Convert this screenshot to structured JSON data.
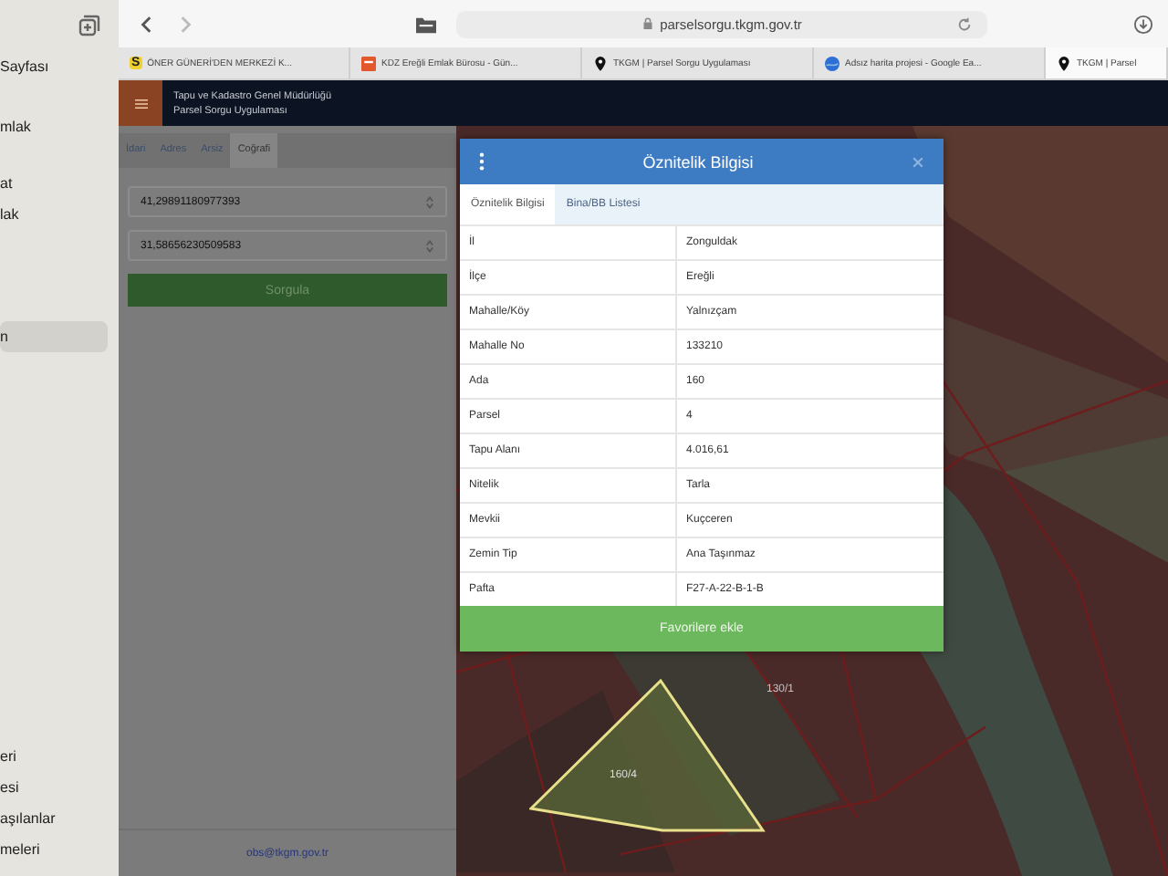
{
  "sidebar": {
    "top_items": [
      {
        "label": "Sayfası",
        "selected": false
      },
      {
        "label": "mlak",
        "selected": false
      },
      {
        "label": "at",
        "selected": false
      },
      {
        "label": "lak",
        "selected": false
      },
      {
        "label": "n",
        "selected": true
      }
    ],
    "bottom_items": [
      {
        "label": "eri",
        "selected": false
      },
      {
        "label": "esi",
        "selected": false
      },
      {
        "label": "aşılanlar",
        "selected": false
      },
      {
        "label": "meleri",
        "selected": false
      }
    ]
  },
  "browser": {
    "url": "parselsorgu.tkgm.gov.tr",
    "tabs": [
      {
        "kind": "letter",
        "badge": "S",
        "title": "ÖNER GÜNERİ'DEN MERKEZİ K...",
        "selected": false
      },
      {
        "kind": "square",
        "title": "KDZ Ereğli Emlak Bürosu - Gün...",
        "selected": false
      },
      {
        "kind": "pin",
        "title": "TKGM | Parsel Sorgu Uygulaması",
        "selected": false
      },
      {
        "kind": "globe",
        "title": "Adsız harita projesi - Google Ea...",
        "selected": false
      },
      {
        "kind": "pin",
        "title": "TKGM | Parsel",
        "selected": true
      }
    ]
  },
  "app": {
    "title_lines": [
      "Tapu ve Kadastro Genel Müdürlüğü",
      "Parsel Sorgu Uygulaması"
    ]
  },
  "panel": {
    "tabs": [
      {
        "label": "İdari",
        "selected": false
      },
      {
        "label": "Adres",
        "selected": false
      },
      {
        "label": "Arsiz",
        "selected": false
      },
      {
        "label": "Coğrafi",
        "selected": true
      }
    ],
    "inputs": [
      {
        "value": "41,29891180977393"
      },
      {
        "value": "31,58656230509583"
      }
    ],
    "button": "Sorgula",
    "footer": "obs@tkgm.gov.tr"
  },
  "modal": {
    "title": "Öznitelik Bilgisi",
    "tabs": [
      {
        "label": "Öznitelik Bilgisi",
        "selected": true
      },
      {
        "label": "Bina/BB Listesi",
        "selected": false
      }
    ],
    "rows": [
      {
        "label": "İl",
        "value": "Zonguldak"
      },
      {
        "label": "İlçe",
        "value": "Ereğli"
      },
      {
        "label": "Mahalle/Köy",
        "value": "Yalnızçam"
      },
      {
        "label": "Mahalle No",
        "value": "133210"
      },
      {
        "label": "Ada",
        "value": "160"
      },
      {
        "label": "Parsel",
        "value": "4"
      },
      {
        "label": "Tapu Alanı",
        "value": "4.016,61"
      },
      {
        "label": "Nitelik",
        "value": "Tarla"
      },
      {
        "label": "Mevkii",
        "value": "Kuçceren"
      },
      {
        "label": "Zemin Tip",
        "value": "Ana Taşınmaz"
      },
      {
        "label": "Pafta",
        "value": "F27-A-22-B-1-B"
      }
    ],
    "button": "Favorilere ekle"
  },
  "map": {
    "labels": [
      {
        "text": "130/1",
        "kind": "parcel"
      },
      {
        "text": "160/4",
        "kind": "selected"
      }
    ]
  }
}
